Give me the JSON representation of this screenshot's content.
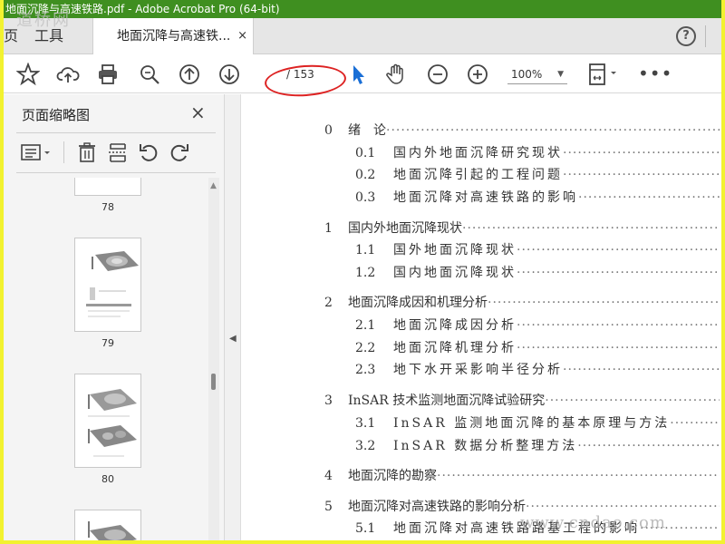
{
  "window": {
    "title": "地面沉降与高速铁路.pdf - Adobe Acrobat Pro (64-bit)"
  },
  "tabs": {
    "home_partial": "页",
    "tools": "工具",
    "document": "地面沉降与高速铁...",
    "close_glyph": "×",
    "help": "?"
  },
  "toolbar": {
    "page_current": "",
    "page_total": "/ 153",
    "zoom": "100%",
    "more": "•••",
    "icons": [
      "star-icon",
      "cloud-upload-icon",
      "print-icon",
      "zoom-search-icon",
      "page-up-icon",
      "page-down-icon",
      "select-cursor-icon",
      "hand-icon",
      "zoom-out-icon",
      "zoom-in-icon",
      "fit-page-icon"
    ]
  },
  "sidebar": {
    "title": "页面缩略图",
    "close_glyph": "×",
    "thumbnails": [
      {
        "label": "78"
      },
      {
        "label": "79"
      },
      {
        "label": "80"
      },
      {
        "label": ""
      }
    ]
  },
  "toc": [
    {
      "num": "0",
      "title": "绪　论",
      "level": 1
    },
    {
      "num": "0.1",
      "title": "国内外地面沉降研究现状",
      "level": 2
    },
    {
      "num": "0.2",
      "title": "地面沉降引起的工程问题",
      "level": 2
    },
    {
      "num": "0.3",
      "title": "地面沉降对高速铁路的影响",
      "level": 2
    },
    {
      "num": "1",
      "title": "国内外地面沉降现状",
      "level": 1
    },
    {
      "num": "1.1",
      "title": "国外地面沉降现状",
      "level": 2
    },
    {
      "num": "1.2",
      "title": "国内地面沉降现状",
      "level": 2
    },
    {
      "num": "2",
      "title": "地面沉降成因和机理分析",
      "level": 1
    },
    {
      "num": "2.1",
      "title": "地面沉降成因分析",
      "level": 2
    },
    {
      "num": "2.2",
      "title": "地面沉降机理分析",
      "level": 2
    },
    {
      "num": "2.3",
      "title": "地下水开采影响半径分析",
      "level": 2
    },
    {
      "num": "3",
      "title": "InSAR 技术监测地面沉降试验研究",
      "level": 1
    },
    {
      "num": "3.1",
      "title": "InSAR 监测地面沉降的基本原理与方法",
      "level": 2
    },
    {
      "num": "3.2",
      "title": "InSAR 数据分析整理方法",
      "level": 2
    },
    {
      "num": "4",
      "title": "地面沉降的勘察",
      "level": 1
    },
    {
      "num": "5",
      "title": "地面沉降对高速铁路的影响分析",
      "level": 1
    },
    {
      "num": "5.1",
      "title": "地面沉降对高速铁路路基工程的影响",
      "level": 2
    }
  ],
  "watermarks": {
    "top": "道桥网",
    "bottom": "www.cndao.com"
  },
  "colors": {
    "titlebar": "#3f8f20",
    "cursor_blue": "#1a6fd6",
    "annotation": "#dd2222",
    "frame": "#f2f230"
  }
}
